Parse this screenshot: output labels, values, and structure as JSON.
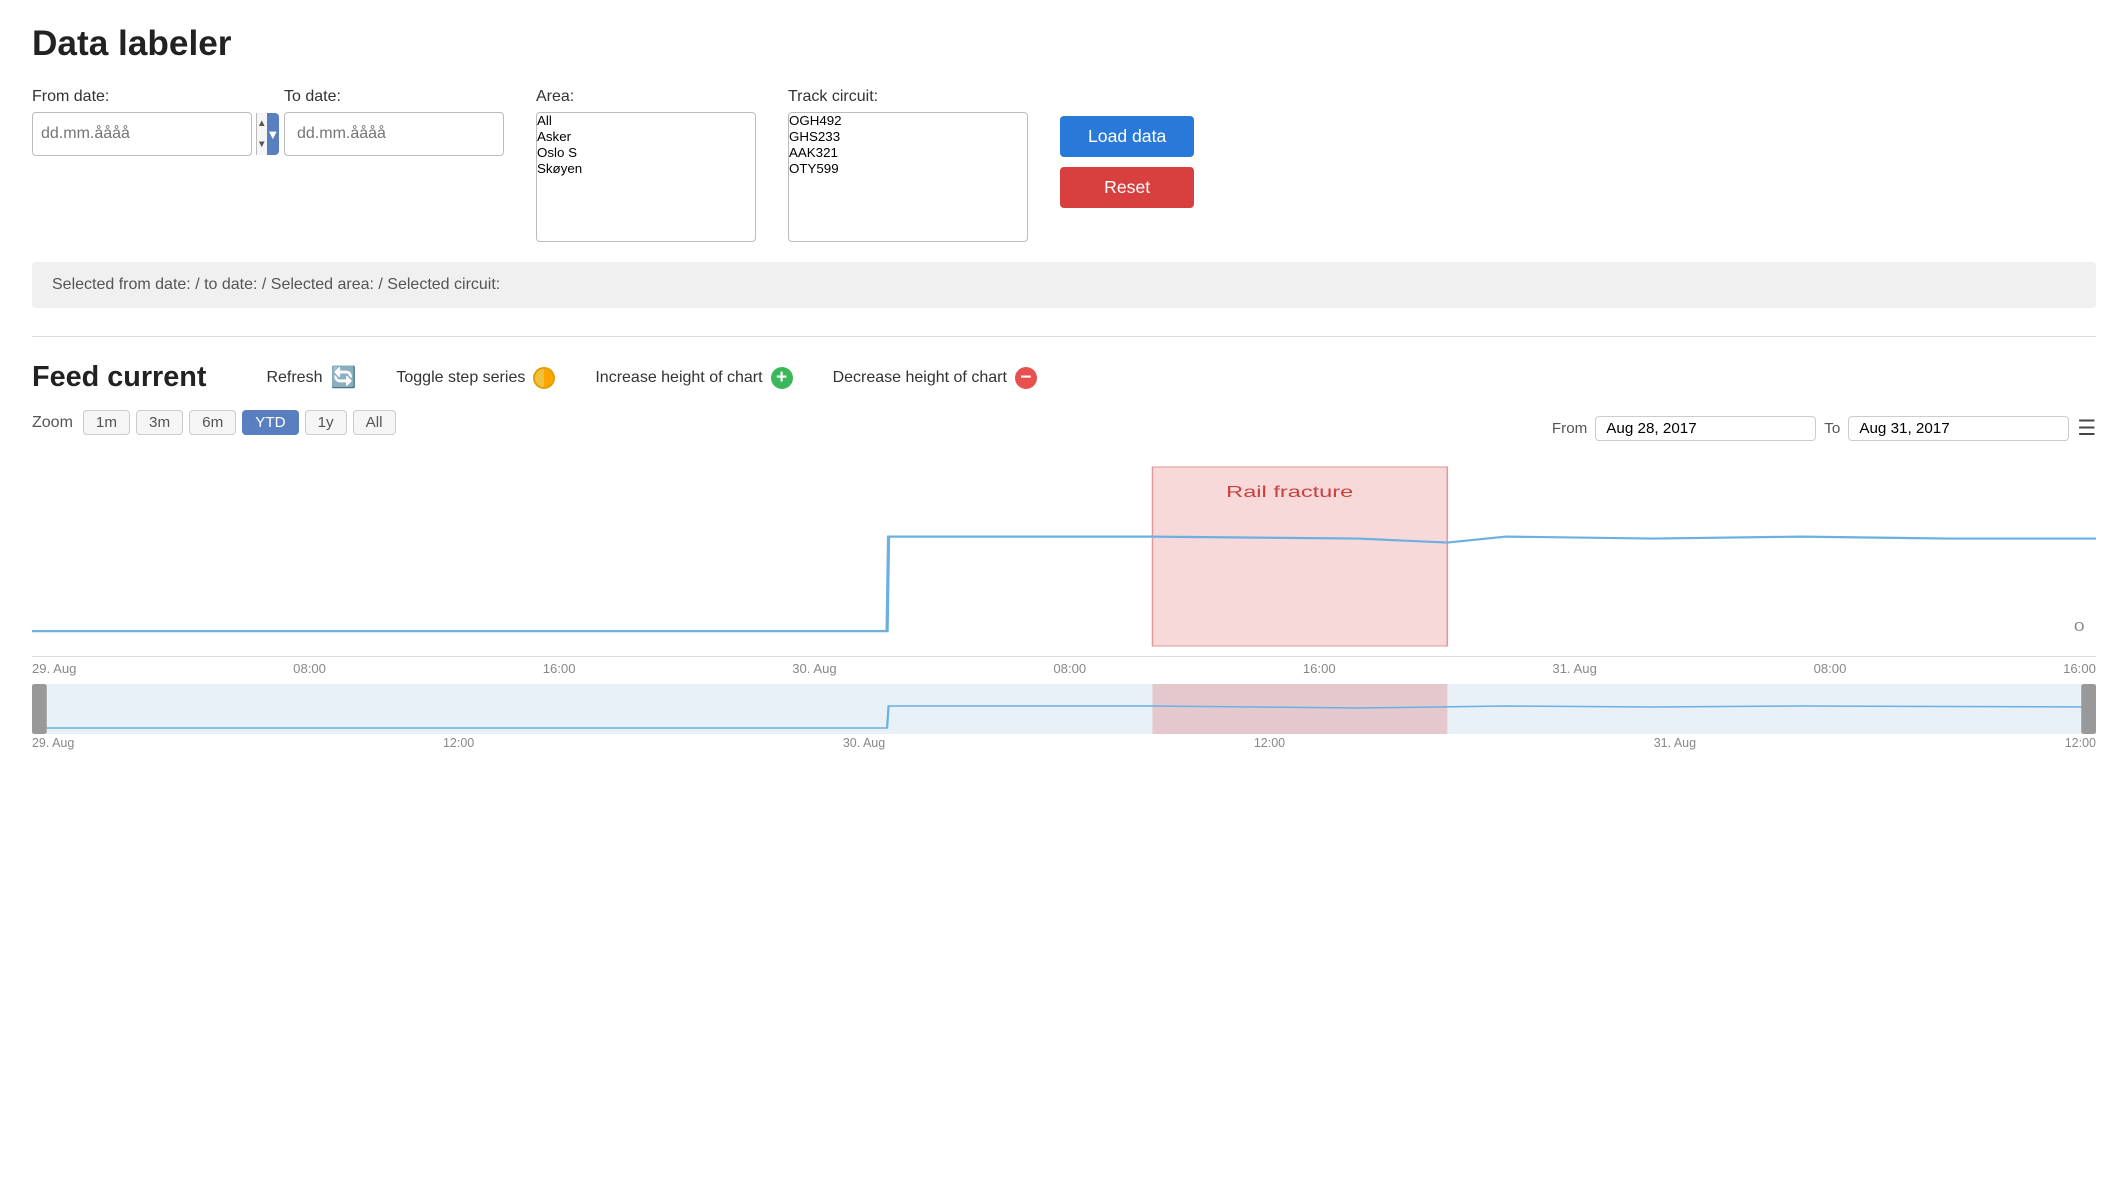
{
  "page": {
    "title": "Data labeler"
  },
  "filters": {
    "from_date_label": "From date:",
    "to_date_label": "To date:",
    "area_label": "Area:",
    "track_circuit_label": "Track circuit:",
    "from_date_placeholder": "dd.mm.åååå",
    "to_date_placeholder": "dd.mm.åååå",
    "area_options": [
      "All",
      "Asker",
      "Oslo S",
      "Skøyen"
    ],
    "track_options": [
      "OGH492",
      "GHS233",
      "AAK321",
      "OTY599"
    ],
    "load_label": "Load data",
    "reset_label": "Reset"
  },
  "status_bar": {
    "text": "Selected from date:  /  to date:  /  Selected area:  /  Selected circuit:"
  },
  "chart": {
    "title": "Feed current",
    "refresh_label": "Refresh",
    "toggle_label": "Toggle step series",
    "increase_label": "Increase height of chart",
    "decrease_label": "Decrease height of chart",
    "zoom_label": "Zoom",
    "zoom_options": [
      "1m",
      "3m",
      "6m",
      "YTD",
      "1y",
      "All"
    ],
    "zoom_active": "YTD",
    "from_label": "From",
    "to_label": "To",
    "from_date": "Aug 28, 2017",
    "to_date": "Aug 31, 2017",
    "x_labels": [
      "29. Aug",
      "08:00",
      "16:00",
      "30. Aug",
      "08:00",
      "16:00",
      "31. Aug",
      "08:00",
      "16:00"
    ],
    "y_value": "0",
    "annotation_label": "Rail fracture",
    "mini_x_labels": [
      "29. Aug",
      "12:00",
      "30. Aug",
      "12:00",
      "31. Aug",
      "12:00"
    ]
  }
}
